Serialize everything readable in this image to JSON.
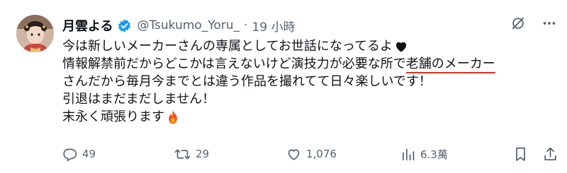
{
  "author": {
    "display_name": "月雲よる",
    "handle": "@Tsukumo_Yoru_",
    "separator": "·",
    "time": "19 小時"
  },
  "tweet": {
    "line1": "今は新しいメーカーさんの専属としてお世話になってるよ",
    "line2_before": "情報解禁前だからどこかは言えないけど演技力が必要な所で",
    "line2_underlined": "老舗のメーカー",
    "line3": "さんだから毎月今までとは違う作品を撮れてて日々楽しいです！",
    "line4": "引退はまだまだしません！",
    "line5": "末永く頑張ります"
  },
  "stats": {
    "replies": "49",
    "retweets": "29",
    "likes": "1,076",
    "views": "6.3萬"
  },
  "colors": {
    "text": "#0f1419",
    "secondary": "#536471",
    "verified": "#1d9bf0",
    "underline": "#e0301e"
  },
  "icons": {
    "header": [
      "verified-badge-icon",
      "grok-icon",
      "more-icon"
    ],
    "line1_end": "black-heart-icon",
    "line5_end": "fire-icon",
    "actions": [
      "reply-icon",
      "retweet-icon",
      "like-icon",
      "views-icon",
      "bookmark-icon",
      "share-icon"
    ]
  }
}
